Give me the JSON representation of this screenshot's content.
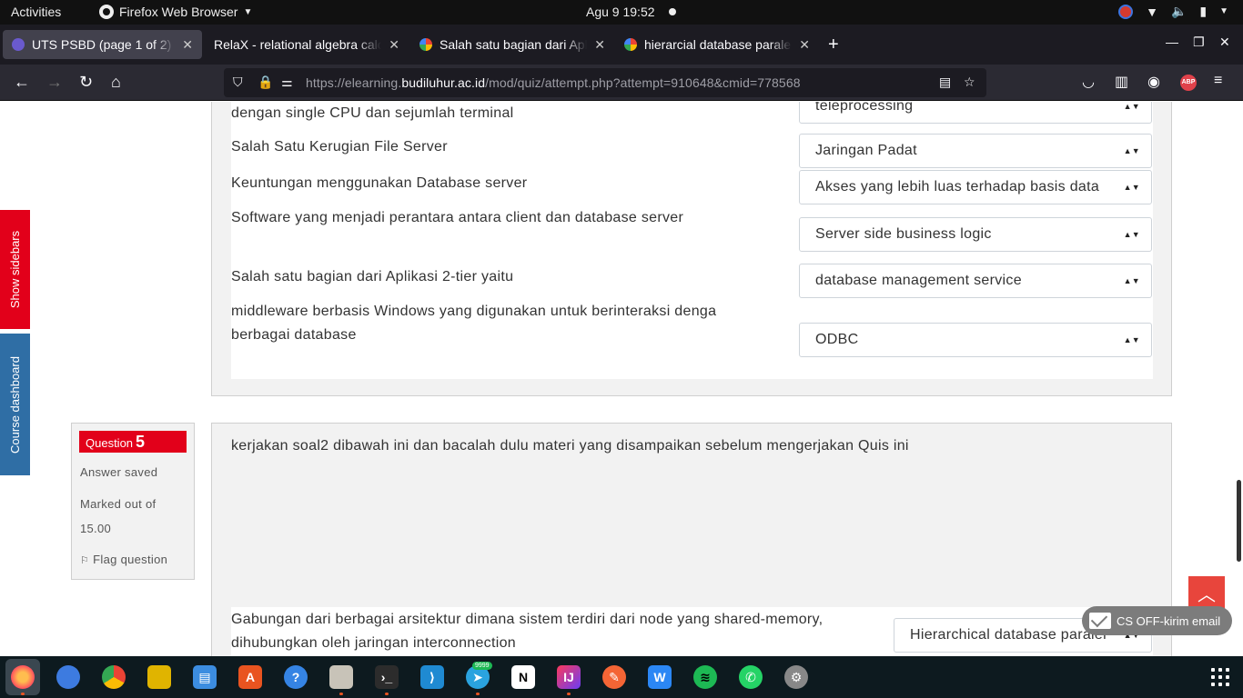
{
  "topbar": {
    "activities": "Activities",
    "app_name": "Firefox Web Browser",
    "clock": "Agu 9  19:52"
  },
  "tabs": [
    {
      "title": "UTS PSBD (page 1 of 2)",
      "active": true
    },
    {
      "title": "RelaX - relational algebra calculator",
      "active": false
    },
    {
      "title": "Salah satu bagian dari Aplikasi",
      "active": false
    },
    {
      "title": "hierarcial database paralel",
      "active": false
    }
  ],
  "navbar": {
    "url_prefix": "https://elearning.",
    "url_domain": "budiluhur.ac.id",
    "url_path": "/mod/quiz/attempt.php?attempt=910648&cmid=778568",
    "abp": "ABP"
  },
  "sidebar_tabs": {
    "show_sidebars": "Show sidebars",
    "course_dashboard": "Course dashboard"
  },
  "question4": {
    "rows": [
      {
        "text": "dengan single CPU dan sejumlah terminal",
        "selected": "teleprocessing"
      },
      {
        "text": "Salah Satu Kerugian File Server",
        "selected": "Jaringan Padat"
      },
      {
        "text": "Keuntungan menggunakan Database server",
        "selected": "Akses yang lebih luas terhadap basis data"
      },
      {
        "text": "Software yang menjadi perantara antara client dan database server",
        "selected": "Server side business logic"
      },
      {
        "text": "Salah satu bagian dari Aplikasi 2-tier  yaitu",
        "selected": "database management service"
      },
      {
        "text_line1": "middleware berbasis Windows yang digunakan untuk berinteraksi denga",
        "text_line2": "berbagai database",
        "selected": "ODBC"
      }
    ]
  },
  "question5": {
    "label": "Question",
    "number": "5",
    "status": "Answer saved",
    "marked_line1": "Marked out of",
    "marked_line2": "15.00",
    "flag": "Flag question",
    "intro": "kerjakan soal2 dibawah ini dan bacalah dulu materi yang disampaikan sebelum mengerjakan Quis ini",
    "row1_line1": "Gabungan dari berbagai arsitektur dimana sistem terdiri dari node yang shared-memory,",
    "row1_line2": "dihubungkan oleh jaringan interconnection",
    "row1_selected": "Hierarchical database paralel"
  },
  "cs_widget": "CS OFF-kirim email",
  "dock": {
    "telegram_badge": "9999"
  }
}
